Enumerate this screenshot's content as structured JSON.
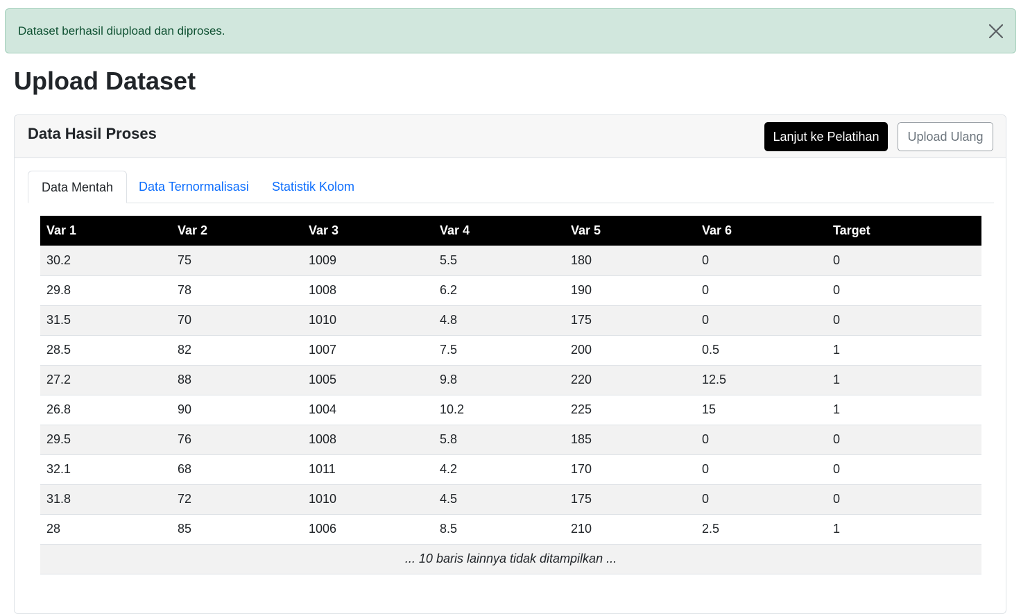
{
  "alert": {
    "message": "Dataset berhasil diupload dan diproses.",
    "close_icon": "close-icon"
  },
  "page": {
    "title": "Upload Dataset"
  },
  "card": {
    "title": "Data Hasil Proses",
    "primary_button": "Lanjut ke Pelatihan",
    "secondary_button": "Upload Ulang"
  },
  "tabs": [
    {
      "label": "Data Mentah",
      "active": true
    },
    {
      "label": "Data Ternormalisasi",
      "active": false
    },
    {
      "label": "Statistik Kolom",
      "active": false
    }
  ],
  "table": {
    "columns": [
      "Var 1",
      "Var 2",
      "Var 3",
      "Var 4",
      "Var 5",
      "Var 6",
      "Target"
    ],
    "rows": [
      [
        "30.2",
        "75",
        "1009",
        "5.5",
        "180",
        "0",
        "0"
      ],
      [
        "29.8",
        "78",
        "1008",
        "6.2",
        "190",
        "0",
        "0"
      ],
      [
        "31.5",
        "70",
        "1010",
        "4.8",
        "175",
        "0",
        "0"
      ],
      [
        "28.5",
        "82",
        "1007",
        "7.5",
        "200",
        "0.5",
        "1"
      ],
      [
        "27.2",
        "88",
        "1005",
        "9.8",
        "220",
        "12.5",
        "1"
      ],
      [
        "26.8",
        "90",
        "1004",
        "10.2",
        "225",
        "15",
        "1"
      ],
      [
        "29.5",
        "76",
        "1008",
        "5.8",
        "185",
        "0",
        "0"
      ],
      [
        "32.1",
        "68",
        "1011",
        "4.2",
        "170",
        "0",
        "0"
      ],
      [
        "31.8",
        "72",
        "1010",
        "4.5",
        "175",
        "0",
        "0"
      ],
      [
        "28",
        "85",
        "1006",
        "8.5",
        "210",
        "2.5",
        "1"
      ]
    ],
    "footer_note": "... 10 baris lainnya tidak ditampilkan ..."
  },
  "colors": {
    "alert_bg": "#d1e7dd",
    "alert_text": "#0f5132",
    "link": "#0d6efd",
    "header_bg": "#000000"
  }
}
